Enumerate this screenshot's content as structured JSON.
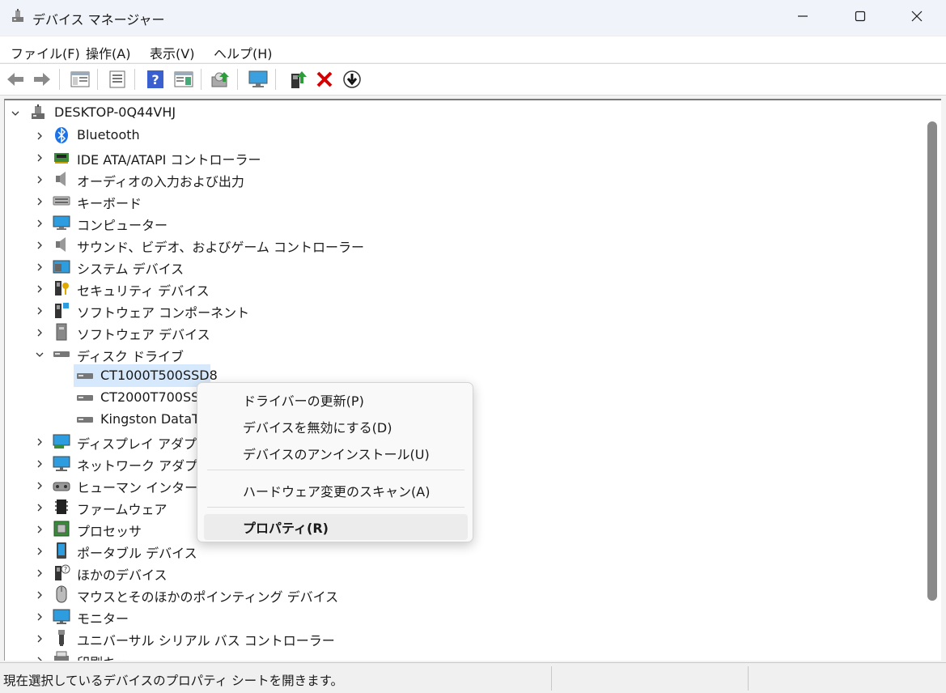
{
  "window": {
    "title": "デバイス マネージャー",
    "icons": [
      "device-manager-icon",
      "minimize-icon",
      "maximize-icon",
      "close-icon"
    ]
  },
  "menubar": {
    "items": [
      "ファイル(F)",
      "操作(A)",
      "表示(V)",
      "ヘルプ(H)"
    ]
  },
  "toolbar": {
    "icons": [
      "back-icon",
      "forward-icon",
      "show-hide-console-tree-icon",
      "properties-sheet-icon",
      "help-icon",
      "action-pane-icon",
      "scan-hardware-icon",
      "monitor-icon",
      "update-driver-icon",
      "uninstall-device-icon",
      "disable-device-icon"
    ]
  },
  "tree": {
    "root": "DESKTOP-0Q44VHJ",
    "categories": [
      {
        "label": "Bluetooth",
        "icon": "bluetooth-icon"
      },
      {
        "label": "IDE ATA/ATAPI コントローラー",
        "icon": "ide-controller-icon"
      },
      {
        "label": "オーディオの入力および出力",
        "icon": "speaker-icon"
      },
      {
        "label": "キーボード",
        "icon": "keyboard-icon"
      },
      {
        "label": "コンピューター",
        "icon": "computer-icon"
      },
      {
        "label": "サウンド、ビデオ、およびゲーム コントローラー",
        "icon": "speaker-icon"
      },
      {
        "label": "システム デバイス",
        "icon": "system-device-icon"
      },
      {
        "label": "セキュリティ デバイス",
        "icon": "security-key-icon"
      },
      {
        "label": "ソフトウェア コンポーネント",
        "icon": "software-component-icon"
      },
      {
        "label": "ソフトウェア デバイス",
        "icon": "software-device-icon"
      },
      {
        "label": "ディスク ドライブ",
        "icon": "disk-drive-icon",
        "expanded": true
      },
      {
        "label": "ディスプレイ アダプター",
        "icon": "display-adapter-icon"
      },
      {
        "label": "ネットワーク アダプター",
        "icon": "network-adapter-icon"
      },
      {
        "label": "ヒューマン インターフェイ",
        "icon": "hid-icon"
      },
      {
        "label": "ファームウェア",
        "icon": "firmware-icon"
      },
      {
        "label": "プロセッサ",
        "icon": "processor-icon"
      },
      {
        "label": "ポータブル デバイス",
        "icon": "portable-device-icon"
      },
      {
        "label": "ほかのデバイス",
        "icon": "other-device-icon"
      },
      {
        "label": "マウスとそのほかのポインティング デバイス",
        "icon": "mouse-icon"
      },
      {
        "label": "モニター",
        "icon": "monitor-icon"
      },
      {
        "label": "ユニバーサル シリアル バス コントローラー",
        "icon": "usb-icon"
      },
      {
        "label": "印刷キュー",
        "icon": "print-queue-icon"
      }
    ],
    "disk_drives": [
      "CT1000T500SSD8",
      "CT2000T700SSD",
      "Kingston DataT"
    ]
  },
  "context_menu": {
    "items": [
      "ドライバーの更新(P)",
      "デバイスを無効にする(D)",
      "デバイスのアンインストール(U)",
      "ハードウェア変更のスキャン(A)",
      "プロパティ(R)"
    ]
  },
  "statusbar": {
    "text": "現在選択しているデバイスのプロパティ シートを開きます。"
  },
  "colors": {
    "selection": "#d6e8fb",
    "titlebar": "#f0f3f9",
    "delete_red": "#d60000"
  }
}
